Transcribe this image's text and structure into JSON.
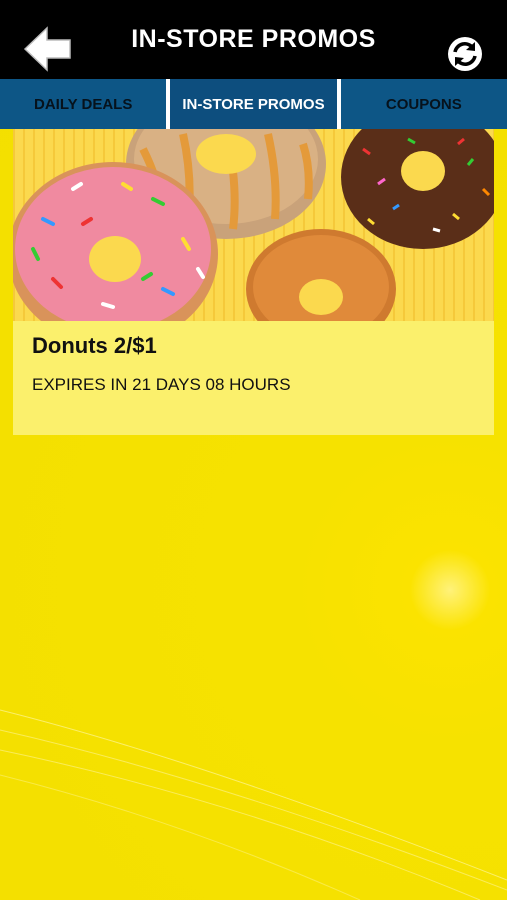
{
  "header": {
    "title": "IN-STORE PROMOS",
    "back_icon": "back-arrow-icon",
    "refresh_icon": "refresh-icon"
  },
  "tabs": [
    {
      "label": "DAILY DEALS",
      "active": false
    },
    {
      "label": "IN-STORE PROMOS",
      "active": true
    },
    {
      "label": "COUPONS",
      "active": false
    }
  ],
  "promos": [
    {
      "title": "Donuts 2/$1",
      "expiry": "EXPIRES IN 21 DAYS 08 HOURS",
      "image": "donuts-photo"
    }
  ],
  "colors": {
    "topbar": "#000000",
    "tab_bg": "#0d5686",
    "background": "#f4e000",
    "card_bg": "#fbf06c"
  }
}
